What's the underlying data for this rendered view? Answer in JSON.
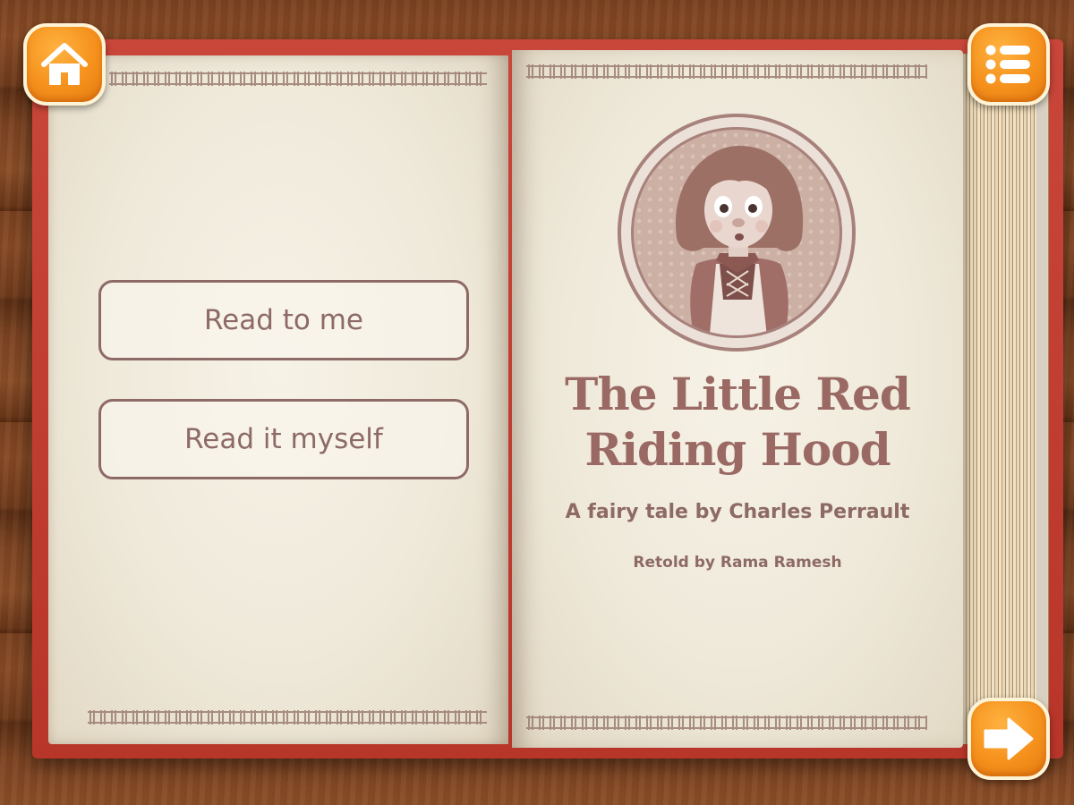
{
  "reading_modes": {
    "read_to_me": "Read to me",
    "read_it_myself": "Read it myself"
  },
  "cover": {
    "title": "The Little Red Riding Hood",
    "subtitle": "A fairy tale by Charles Perrault",
    "credit": "Retold by Rama Ramesh",
    "illustration": "little-red-riding-hood-portrait"
  },
  "navigation": {
    "home_icon": "home-icon",
    "menu_icon": "list-menu-icon",
    "next_icon": "arrow-right-icon"
  },
  "colors": {
    "accent_orange": "#f5911c",
    "text_brown": "#8e6a66",
    "book_red": "#c9463a",
    "paper": "#f3eee2"
  }
}
